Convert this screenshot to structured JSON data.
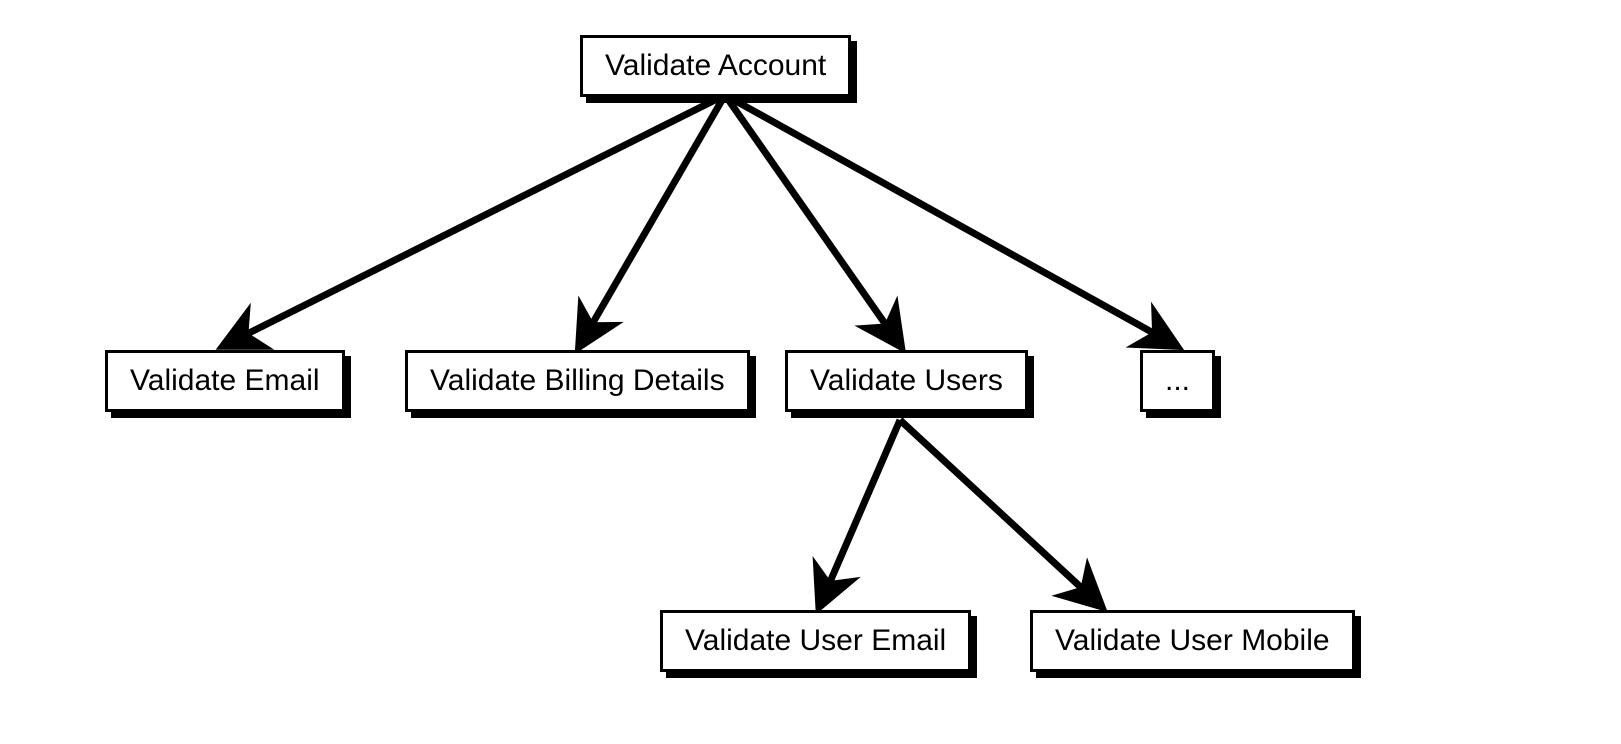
{
  "diagram": {
    "type": "tree",
    "nodes": {
      "root": {
        "label": "Validate Account"
      },
      "email": {
        "label": "Validate Email"
      },
      "billing": {
        "label": "Validate Billing Details"
      },
      "users": {
        "label": "Validate Users"
      },
      "more": {
        "label": "..."
      },
      "userEmail": {
        "label": "Validate User Email"
      },
      "userMobile": {
        "label": "Validate User Mobile"
      }
    },
    "edges": [
      {
        "from": "root",
        "to": "email"
      },
      {
        "from": "root",
        "to": "billing"
      },
      {
        "from": "root",
        "to": "users"
      },
      {
        "from": "root",
        "to": "more"
      },
      {
        "from": "users",
        "to": "userEmail"
      },
      {
        "from": "users",
        "to": "userMobile"
      }
    ]
  }
}
